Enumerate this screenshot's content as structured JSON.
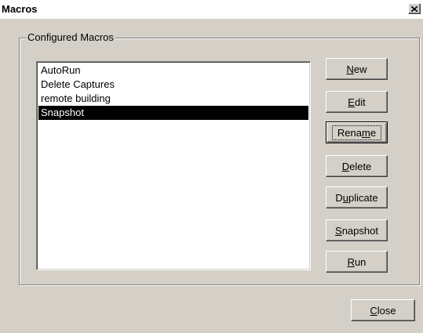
{
  "window": {
    "title": "Macros"
  },
  "group": {
    "label": "Configured Macros"
  },
  "macros": {
    "items": [
      {
        "label": "AutoRun",
        "selected": false
      },
      {
        "label": "Delete Captures",
        "selected": false
      },
      {
        "label": "remote building",
        "selected": false
      },
      {
        "label": "Snapshot",
        "selected": true
      }
    ]
  },
  "buttons": {
    "new": {
      "before": "",
      "mnemonic": "N",
      "after": "ew"
    },
    "edit": {
      "before": "",
      "mnemonic": "E",
      "after": "dit"
    },
    "rename": {
      "before": "Rena",
      "mnemonic": "m",
      "after": "e"
    },
    "delete": {
      "before": "",
      "mnemonic": "D",
      "after": "elete"
    },
    "duplicate": {
      "before": "D",
      "mnemonic": "u",
      "after": "plicate"
    },
    "snapshot": {
      "before": "",
      "mnemonic": "S",
      "after": "napshot"
    },
    "run": {
      "before": "",
      "mnemonic": "R",
      "after": "un"
    },
    "close": {
      "before": "",
      "mnemonic": "C",
      "after": "lose"
    }
  },
  "icons": {
    "close": "close-icon"
  },
  "colors": {
    "face": "#d4d0c8",
    "selection": "#000000",
    "selection_text": "#ffffff"
  }
}
